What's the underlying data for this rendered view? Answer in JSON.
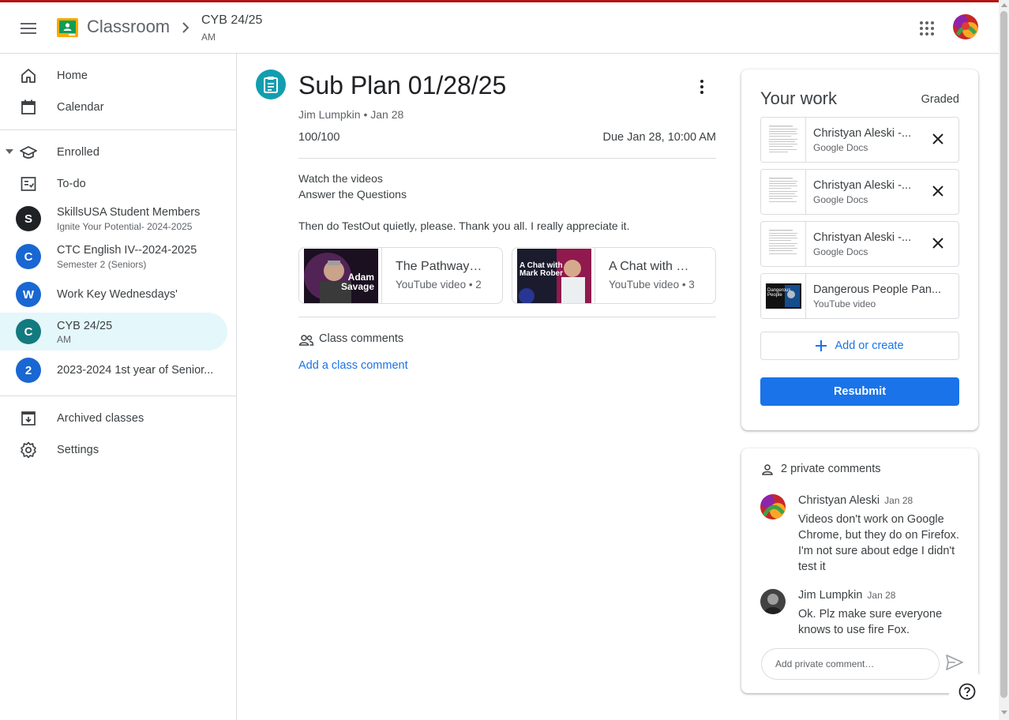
{
  "header": {
    "app_title": "Classroom",
    "crumb_title": "CYB 24/25",
    "crumb_sub": "AM"
  },
  "sidebar": {
    "nav": [
      {
        "label": "Home",
        "icon": "home-icon"
      },
      {
        "label": "Calendar",
        "icon": "calendar-icon"
      }
    ],
    "enrolled_label": "Enrolled",
    "todo_label": "To-do",
    "classes": [
      {
        "letter": "S",
        "name": "SkillsUSA Student Members",
        "sub": "Ignite Your Potential- 2024-2025",
        "color": "#202124"
      },
      {
        "letter": "C",
        "name": "CTC English IV--2024-2025",
        "sub": "Semester 2 (Seniors)",
        "color": "#1967d2"
      },
      {
        "letter": "W",
        "name": "Work Key Wednesdays'",
        "sub": "",
        "color": "#1967d2"
      },
      {
        "letter": "C",
        "name": "CYB 24/25",
        "sub": "AM",
        "color": "#137a7f",
        "active": true
      },
      {
        "letter": "2",
        "name": "2023-2024 1st year of Senior...",
        "sub": "",
        "color": "#1967d2"
      }
    ],
    "bottom": [
      {
        "label": "Archived classes",
        "icon": "archive-icon"
      },
      {
        "label": "Settings",
        "icon": "gear-icon"
      }
    ]
  },
  "assignment": {
    "title": "Sub Plan 01/28/25",
    "meta": "Jim Lumpkin • Jan 28",
    "points": "100/100",
    "due": "Due Jan 28, 10:00 AM",
    "lines": [
      "Watch the videos",
      "Answer the Questions",
      "Then do TestOut quietly, please.  Thank you all.  I really appreciate it."
    ],
    "videos": [
      {
        "title": "The Pathway…",
        "sub": "YouTube video • 2",
        "thumb_text": "Adam Savage"
      },
      {
        "title": "A Chat with …",
        "sub": "YouTube video • 3",
        "thumb_text": "A Chat with Mark Rober"
      }
    ],
    "class_comments_label": "Class comments",
    "add_class_comment": "Add a class comment"
  },
  "your_work": {
    "title": "Your work",
    "status": "Graded",
    "attachments": [
      {
        "name": "Christyan Aleski -...",
        "type": "Google Docs",
        "removable": true
      },
      {
        "name": "Christyan Aleski -...",
        "type": "Google Docs",
        "removable": true
      },
      {
        "name": "Christyan Aleski -...",
        "type": "Google Docs",
        "removable": true
      },
      {
        "name": "Dangerous People Pan...",
        "type": "YouTube video",
        "removable": false,
        "thumb_text": "Dangerous People"
      }
    ],
    "add_or_create": "Add or create",
    "resubmit": "Resubmit"
  },
  "private_comments": {
    "header": "2 private comments",
    "comments": [
      {
        "author": "Christyan Aleski",
        "date": "Jan 28",
        "text": "Videos don't work on Google Chrome, but they do on Firefox. I'm not sure about edge I didn't test it"
      },
      {
        "author": "Jim Lumpkin",
        "date": "Jan 28",
        "text": "Ok. Plz make sure everyone knows to use fire Fox."
      }
    ],
    "input_placeholder": "Add private comment…"
  },
  "colors": {
    "accent": "#1a73e8",
    "assignment_icon": "#129eaf",
    "active_class_bg": "#e4f7fb",
    "top_bar": "#b31412"
  }
}
